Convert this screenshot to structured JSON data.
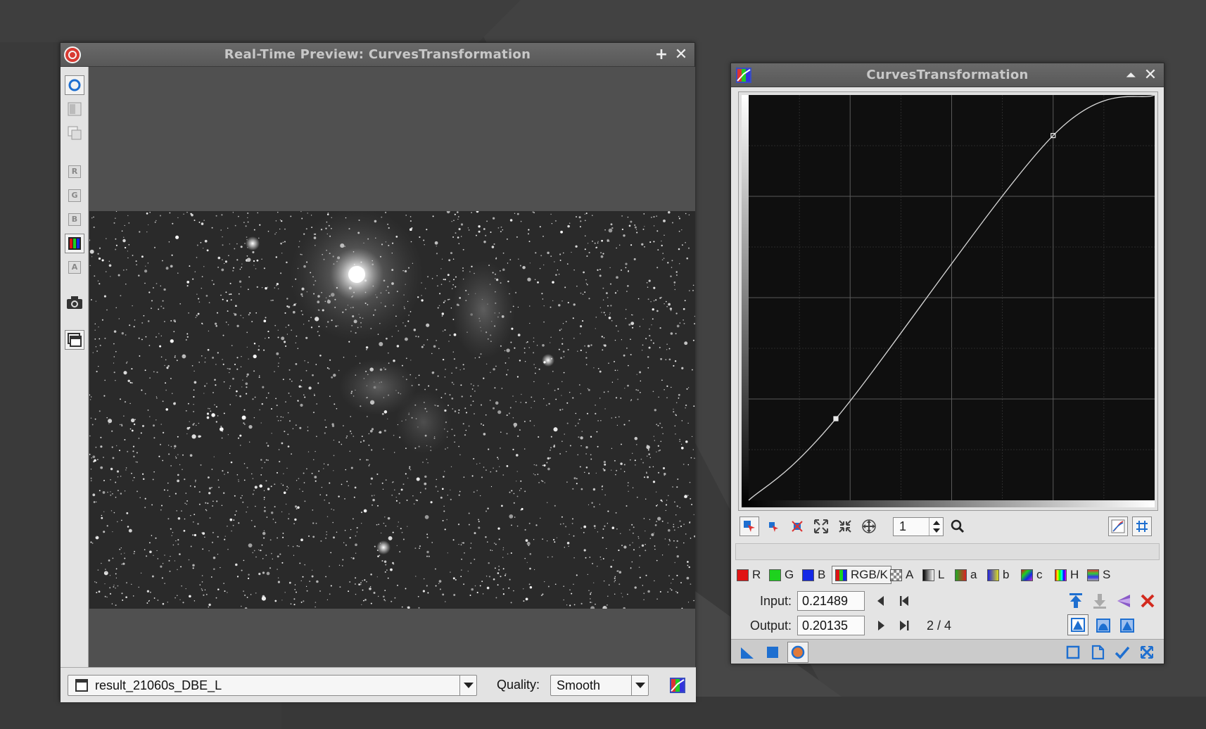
{
  "preview_window": {
    "title": "Real-Time Preview: CurvesTransformation",
    "image_selector": {
      "value": "result_21060s_DBE_L"
    },
    "quality_label": "Quality:",
    "quality_select": {
      "value": "Smooth"
    },
    "left_toolbar": {
      "channel_r": "R",
      "channel_g": "G",
      "channel_b": "B",
      "channel_a": "A"
    }
  },
  "curves_window": {
    "title": "CurvesTransformation",
    "zoom_value": "1",
    "channels": [
      {
        "label": "R",
        "color": "#e01414"
      },
      {
        "label": "G",
        "color": "#1ed21e"
      },
      {
        "label": "B",
        "color": "#1428e6"
      },
      {
        "label": "RGB/K",
        "color": "multi"
      },
      {
        "label": "A",
        "color": "checker"
      },
      {
        "label": "L",
        "color": "gray-gradient"
      },
      {
        "label": "a",
        "color": "red-green"
      },
      {
        "label": "b",
        "color": "blue-yellow"
      },
      {
        "label": "c",
        "color": "multi"
      },
      {
        "label": "H",
        "color": "hue"
      },
      {
        "label": "S",
        "color": "multi"
      }
    ],
    "selected_channel": "RGB/K",
    "input_label": "Input:",
    "input_value": "0.21489",
    "output_label": "Output:",
    "output_value": "0.20135",
    "point_counter": "2 / 4",
    "curve_points": [
      [
        0,
        0
      ],
      [
        0.21489,
        0.20135
      ],
      [
        0.75,
        0.9
      ],
      [
        1,
        1
      ]
    ]
  },
  "colors": {
    "desktop": "#3a3a3a",
    "title_text": "#c8c8c8",
    "panel_bg": "#e4e4e4",
    "accent_blue": "#1e6fd0",
    "close_red": "#d83a32"
  }
}
